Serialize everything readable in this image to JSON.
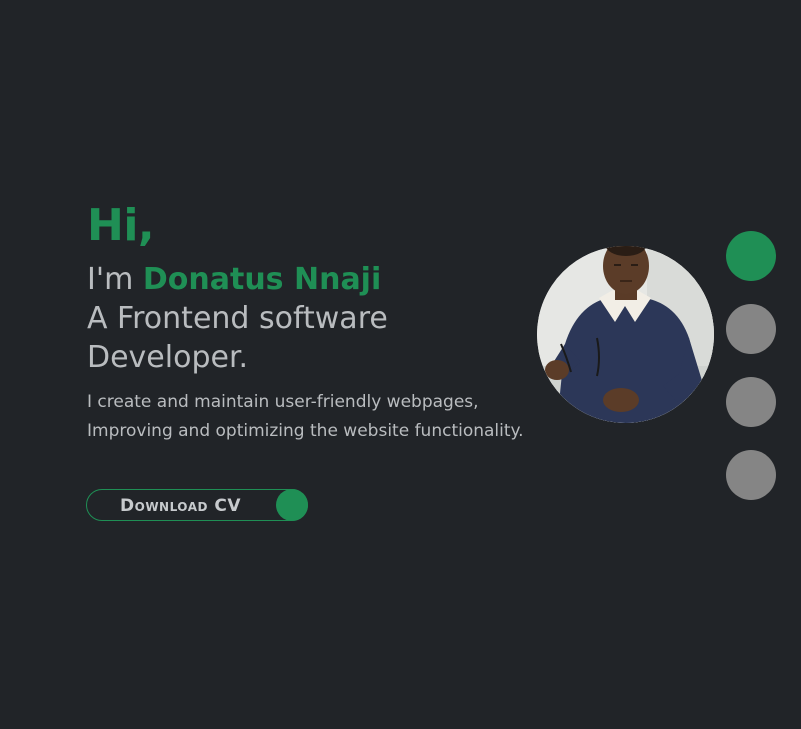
{
  "hero": {
    "greeting": "Hi,",
    "intro_prefix": "I'm ",
    "name": "Donatus Nnaji",
    "role_line1": "A Frontend software",
    "role_line2": "Developer.",
    "tagline_line1": "I create and maintain user-friendly webpages,",
    "tagline_line2": "Improving and optimizing the website functionality."
  },
  "cv_button": {
    "label": "Download CV"
  },
  "avatar": {
    "icon": "profile-photo"
  },
  "slider": {
    "active_index": 0,
    "dots": [
      {
        "active": true
      },
      {
        "active": false
      },
      {
        "active": false
      },
      {
        "active": false
      }
    ]
  },
  "colors": {
    "background": "#212428",
    "accent": "#1f8f55",
    "text": "#b9bcbf",
    "inactive_dot": "#858585"
  }
}
